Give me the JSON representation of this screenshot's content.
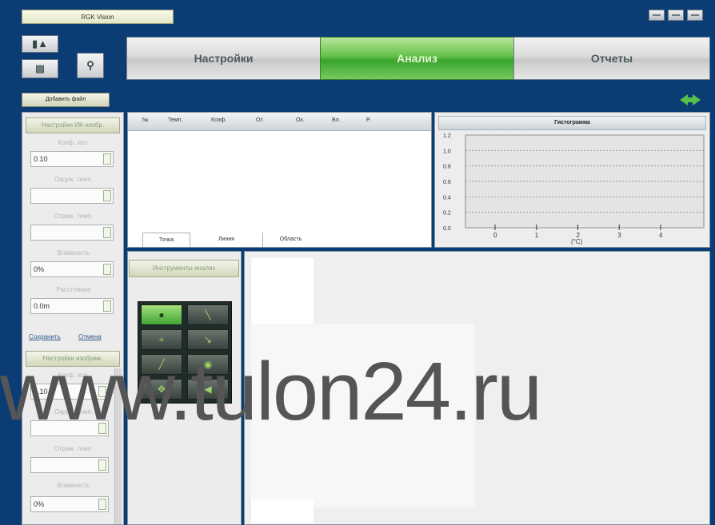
{
  "window": {
    "title": "RGK Vision",
    "controls": [
      "minimize-icon",
      "maximize-icon",
      "close-icon"
    ]
  },
  "toolbar": {
    "icons": [
      "camera-icon",
      "printer-icon",
      "search-zoom-icon"
    ]
  },
  "main_tabs": [
    {
      "label": "Настройки",
      "active": false
    },
    {
      "label": "Анализ",
      "active": true
    },
    {
      "label": "Отчеты",
      "active": false
    }
  ],
  "add_file_label": "Добавить файл",
  "left_panel": {
    "ir_settings_header": "Настройки ИК-изобр.",
    "fields": [
      {
        "label": "Коэф. изл.",
        "value": "0.10"
      },
      {
        "label": "Окруж. темп.",
        "value": ""
      },
      {
        "label": "Отраж. темп.",
        "value": ""
      },
      {
        "label": "Влажность",
        "value": "0%"
      },
      {
        "label": "Расстояние",
        "value": "0.0m"
      }
    ],
    "save_link": "Сохранить",
    "cancel_link": "Отмена",
    "photo_settings_header": "Настройки изображ.",
    "fields2": [
      {
        "label": "Коэф. изл.",
        "value": "0.10"
      },
      {
        "label": "Окруж. темп.",
        "value": ""
      },
      {
        "label": "Отраж. темп.",
        "value": ""
      },
      {
        "label": "Влажность",
        "value": "0%"
      }
    ]
  },
  "table": {
    "columns": [
      "№",
      "Темп.",
      "Коэф.",
      "От.",
      "Ох.",
      "Вл.",
      "Р."
    ],
    "sub_tabs": [
      "Точка",
      "Линия",
      "Область"
    ]
  },
  "histogram": {
    "title": "Гистограмма",
    "y_ticks": [
      "1.2",
      "1.0",
      "0.8",
      "0.6",
      "0.4",
      "0.2",
      "0.0"
    ],
    "x_ticks": [
      "0",
      "1",
      "2",
      "3",
      "4"
    ],
    "x_unit": "(°C)"
  },
  "tools": {
    "header": "Инструменты анализ",
    "items": [
      {
        "name": "point-tool-icon",
        "active": true
      },
      {
        "name": "line-tool-icon",
        "active": false
      },
      {
        "name": "crosshair-tool-icon",
        "active": false
      },
      {
        "name": "arrow-tool-icon",
        "active": false
      },
      {
        "name": "diagonal-line-tool-icon",
        "active": false
      },
      {
        "name": "palette-tool-icon",
        "active": false
      },
      {
        "name": "move-tool-icon",
        "active": false
      },
      {
        "name": "back-arrow-tool-icon",
        "active": false
      }
    ]
  },
  "watermark": "www.tulon24.ru",
  "colors": {
    "background": "#0b3d74",
    "accent_green": "#4cb43a",
    "panel_bg": "#ececec"
  }
}
